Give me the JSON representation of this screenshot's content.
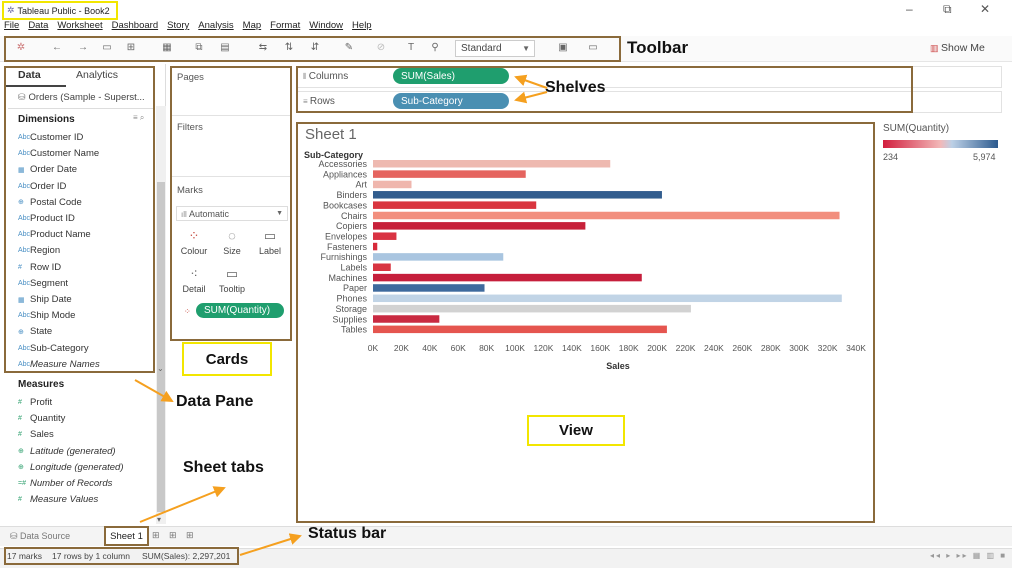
{
  "window": {
    "title": "Tableau Public - Book2",
    "minimize": "–",
    "restore": "⧉",
    "close": "✕"
  },
  "menu": [
    "File",
    "Data",
    "Worksheet",
    "Dashboard",
    "Story",
    "Analysis",
    "Map",
    "Format",
    "Window",
    "Help"
  ],
  "toolbar": {
    "fit_select": "Standard",
    "show_me": "Show Me"
  },
  "data_pane": {
    "tabs": [
      "Data",
      "Analytics"
    ],
    "source": "Orders (Sample - Superst...",
    "dimensions_heading": "Dimensions",
    "dimensions": [
      {
        "icon": "Abc",
        "label": "Customer ID"
      },
      {
        "icon": "Abc",
        "label": "Customer Name"
      },
      {
        "icon": "▦",
        "label": "Order Date"
      },
      {
        "icon": "Abc",
        "label": "Order ID"
      },
      {
        "icon": "⊕",
        "label": "Postal Code"
      },
      {
        "icon": "Abc",
        "label": "Product ID"
      },
      {
        "icon": "Abc",
        "label": "Product Name"
      },
      {
        "icon": "Abc",
        "label": "Region"
      },
      {
        "icon": "#",
        "label": "Row ID"
      },
      {
        "icon": "Abc",
        "label": "Segment"
      },
      {
        "icon": "▦",
        "label": "Ship Date"
      },
      {
        "icon": "Abc",
        "label": "Ship Mode"
      },
      {
        "icon": "⊕",
        "label": "State"
      },
      {
        "icon": "Abc",
        "label": "Sub-Category"
      },
      {
        "icon": "Abc",
        "label": "Measure Names"
      }
    ],
    "measures_heading": "Measures",
    "measures": [
      {
        "icon": "#",
        "label": "Profit"
      },
      {
        "icon": "#",
        "label": "Quantity"
      },
      {
        "icon": "#",
        "label": "Sales"
      },
      {
        "icon": "⊕",
        "label": "Latitude (generated)"
      },
      {
        "icon": "⊕",
        "label": "Longitude (generated)"
      },
      {
        "icon": "=#",
        "label": "Number of Records"
      },
      {
        "icon": "#",
        "label": "Measure Values"
      }
    ]
  },
  "cards": {
    "pages": "Pages",
    "filters": "Filters",
    "marks": "Marks",
    "mark_type": "Automatic",
    "buttons": [
      "Colour",
      "Size",
      "Label",
      "Detail",
      "Tooltip"
    ],
    "color_pill": "SUM(Quantity)"
  },
  "shelves": {
    "columns_label": "Columns",
    "columns_pill": "SUM(Sales)",
    "rows_label": "Rows",
    "rows_pill": "Sub-Category"
  },
  "view": {
    "sheet_title": "Sheet 1"
  },
  "legend": {
    "title": "SUM(Quantity)",
    "min": "234",
    "max": "5,974"
  },
  "sheet_tabs": {
    "data_source": "Data Source",
    "active_sheet": "Sheet 1"
  },
  "status": {
    "marks": "17 marks",
    "rows": "17 rows by 1 column",
    "sum": "SUM(Sales): 2,297,201"
  },
  "annotations": {
    "toolbar": "Toolbar",
    "shelves": "Shelves",
    "cards": "Cards",
    "data_pane": "Data Pane",
    "view": "View",
    "sheet_tabs": "Sheet tabs",
    "status_bar": "Status bar"
  },
  "colors": {
    "annotation_box": "#8a6a3b",
    "highlight": "#f2e600",
    "arrow": "#f5a01f",
    "measure_pill": "#1f9e6e",
    "dimension_pill": "#4a8fb2"
  },
  "chart_data": {
    "type": "bar",
    "orientation": "horizontal",
    "ylabel": "Sub-Category",
    "xlabel": "Sales",
    "xlim": [
      0,
      340000
    ],
    "xticks": [
      "0K",
      "20K",
      "40K",
      "60K",
      "80K",
      "100K",
      "120K",
      "140K",
      "160K",
      "180K",
      "200K",
      "220K",
      "240K",
      "260K",
      "280K",
      "300K",
      "320K",
      "340K"
    ],
    "categories": [
      "Accessories",
      "Appliances",
      "Art",
      "Binders",
      "Bookcases",
      "Chairs",
      "Copiers",
      "Envelopes",
      "Fasteners",
      "Furnishings",
      "Labels",
      "Machines",
      "Paper",
      "Phones",
      "Storage",
      "Supplies",
      "Tables"
    ],
    "values": [
      167000,
      107500,
      27100,
      203400,
      114900,
      328400,
      149500,
      16500,
      3000,
      91700,
      12500,
      189200,
      78500,
      330000,
      223800,
      46700,
      206900
    ],
    "colors": [
      "#eeb9b0",
      "#e5645f",
      "#efb6ad",
      "#325d8e",
      "#d9353f",
      "#f28f7e",
      "#c7213a",
      "#d93343",
      "#d72a3a",
      "#a9c5e0",
      "#d83441",
      "#c61f3c",
      "#3e6a9d",
      "#c1d4e6",
      "#d2d2d2",
      "#c92a41",
      "#e5554f"
    ]
  }
}
